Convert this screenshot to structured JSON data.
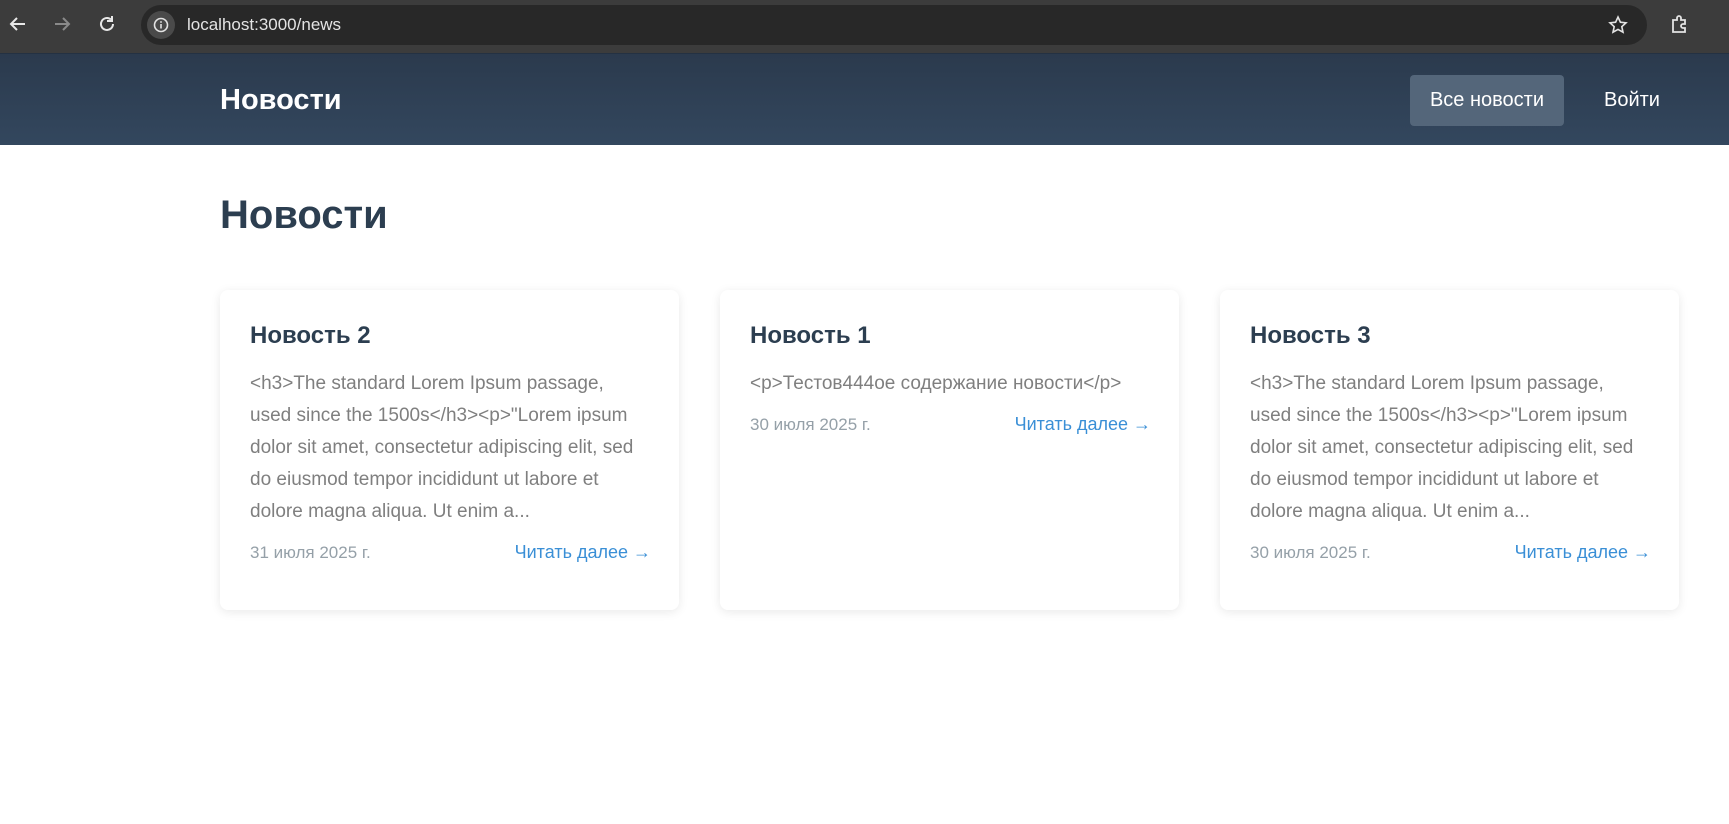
{
  "browser": {
    "url": "localhost:3000/news"
  },
  "header": {
    "brand": "Новости",
    "nav": {
      "all_news": "Все новости",
      "login": "Войти"
    }
  },
  "main": {
    "title": "Новости",
    "cards": [
      {
        "title": "Новость 2",
        "excerpt": "<h3>The standard Lorem Ipsum passage, used since the 1500s</h3><p>\"Lorem ipsum dolor sit amet, consectetur adipiscing elit, sed do eiusmod tempor incididunt ut labore et dolore magna aliqua. Ut enim a...",
        "date": "31 июля 2025 г.",
        "read_more": "Читать далее →"
      },
      {
        "title": "Новость 1",
        "excerpt": "<p>Тестов444ое содержание новости</p>",
        "date": "30 июля 2025 г.",
        "read_more": "Читать далее →"
      },
      {
        "title": "Новость 3",
        "excerpt": "<h3>The standard Lorem Ipsum passage, used since the 1500s</h3><p>\"Lorem ipsum dolor sit amet, consectetur adipiscing elit, sed do eiusmod tempor incididunt ut labore et dolore magna aliqua. Ut enim a...",
        "date": "30 июля 2025 г.",
        "read_more": "Читать далее →"
      }
    ]
  },
  "colors": {
    "header_bg": "#2c3e50",
    "active_nav_bg": "#54667a",
    "link": "#3a8fd6",
    "title": "#2c3e50"
  }
}
